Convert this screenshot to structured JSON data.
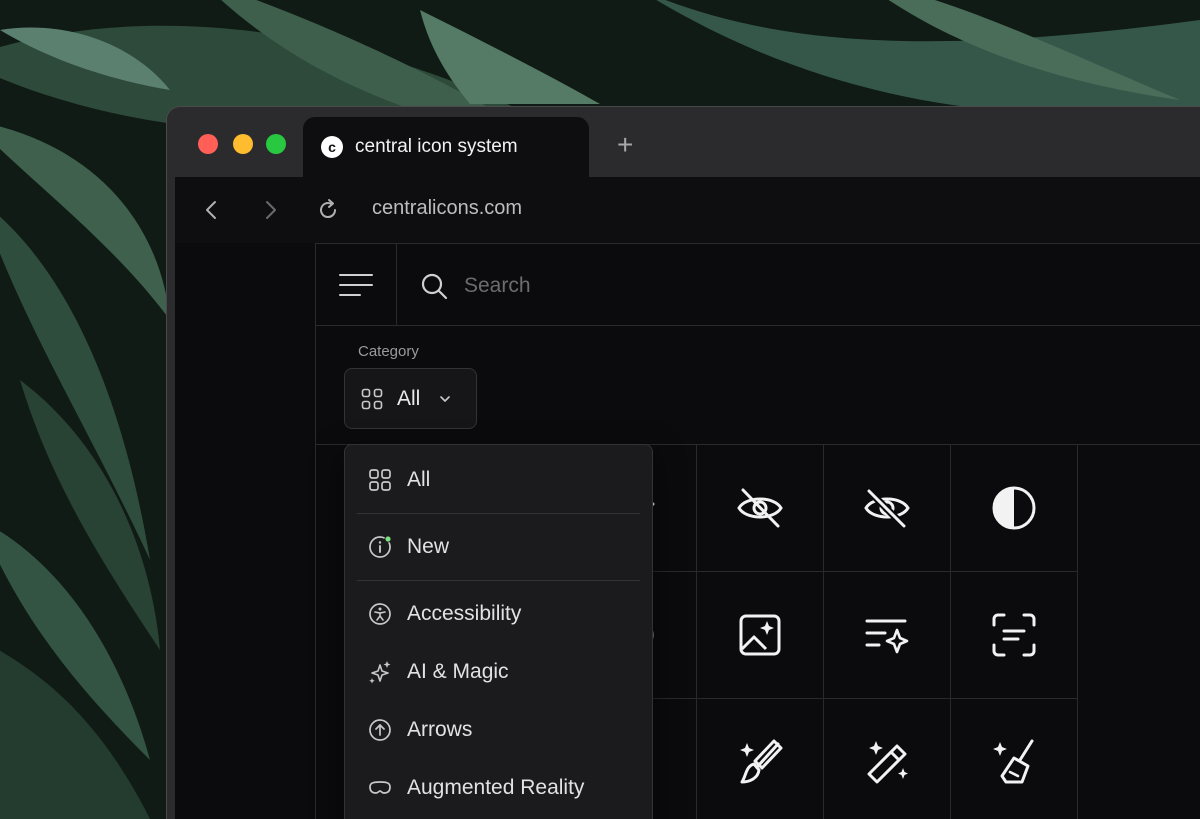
{
  "browser": {
    "tab_title": "central icon system",
    "favicon_letter": "c",
    "new_tab_symbol": "+",
    "url": "centralicons.com"
  },
  "search": {
    "placeholder": "Search"
  },
  "category": {
    "label": "Category",
    "selected": "All"
  },
  "dropdown": {
    "items": [
      {
        "label": "All",
        "icon": "grid-icon"
      },
      {
        "label": "New",
        "icon": "info-badge-icon"
      },
      {
        "label": "Accessibility",
        "icon": "accessibility-icon"
      },
      {
        "label": "AI & Magic",
        "icon": "sparkles-icon"
      },
      {
        "label": "Arrows",
        "icon": "arrow-up-circle-icon"
      },
      {
        "label": "Augmented Reality",
        "icon": "vr-headset-icon"
      }
    ]
  },
  "grid_icons": [
    "eye-closed-icon",
    "eye-slash-icon",
    "eye-slash-alt-icon",
    "contrast-icon",
    "eye-scan-icon",
    "image-sparkle-icon",
    "text-sparkle-icon",
    "scan-text-icon",
    "book-sparkle-icon",
    "magic-brush-icon",
    "magic-wand-icon",
    "magic-broom-icon"
  ],
  "colors": {
    "window_bg": "#2b2b2d",
    "page_bg": "#0b0b0d",
    "accent_dot": "#7ee07e",
    "text_primary": "#e2e2e4"
  }
}
